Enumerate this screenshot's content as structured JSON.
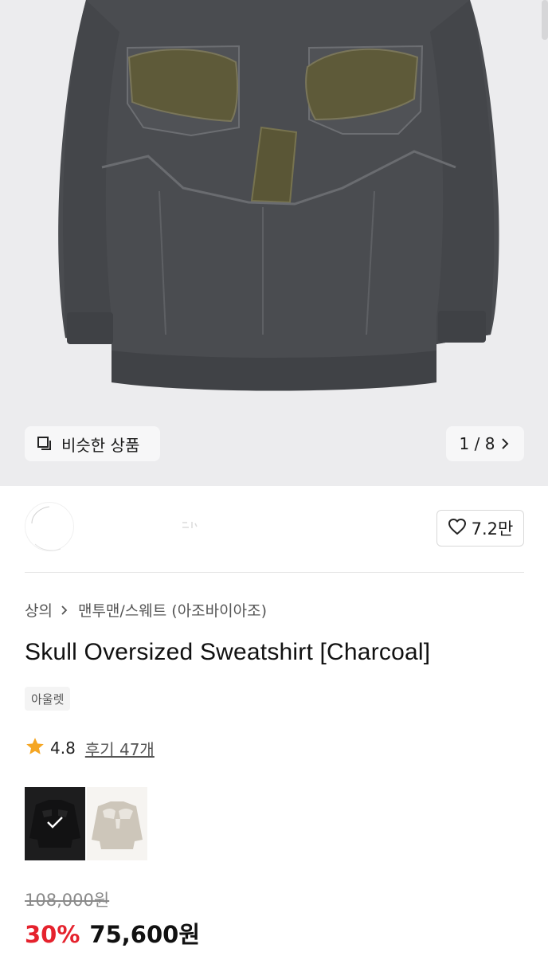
{
  "gallery": {
    "similar_button_label": "비슷한 상품",
    "page_indicator": "1 / 8"
  },
  "brand": {
    "like_count": "7.2만"
  },
  "breadcrumb": {
    "category": "상의",
    "subcategory": "맨투맨/스웨트 (아조바이아조)"
  },
  "product": {
    "title": "Skull Oversized Sweatshirt [Charcoal]",
    "tag": "아울렛",
    "rating": "4.8",
    "reviews_label": "후기 47개",
    "color_options": [
      {
        "name": "charcoal",
        "selected": true
      },
      {
        "name": "beige",
        "selected": false
      }
    ],
    "original_price": "108,000원",
    "discount": "30%",
    "sale_price": "75,600원"
  },
  "colors": {
    "discount_red": "#e5222d",
    "star_yellow": "#f5a623",
    "sweatshirt_charcoal": "#4a4c50",
    "patch_olive": "#5e5a39"
  },
  "icons": {
    "similar": "copy-square-icon",
    "next": "chevron-right-icon",
    "like": "heart-outline-icon",
    "breadcrumb_separator": "chevron-right-icon",
    "rating": "star-icon",
    "selected": "check-icon"
  }
}
